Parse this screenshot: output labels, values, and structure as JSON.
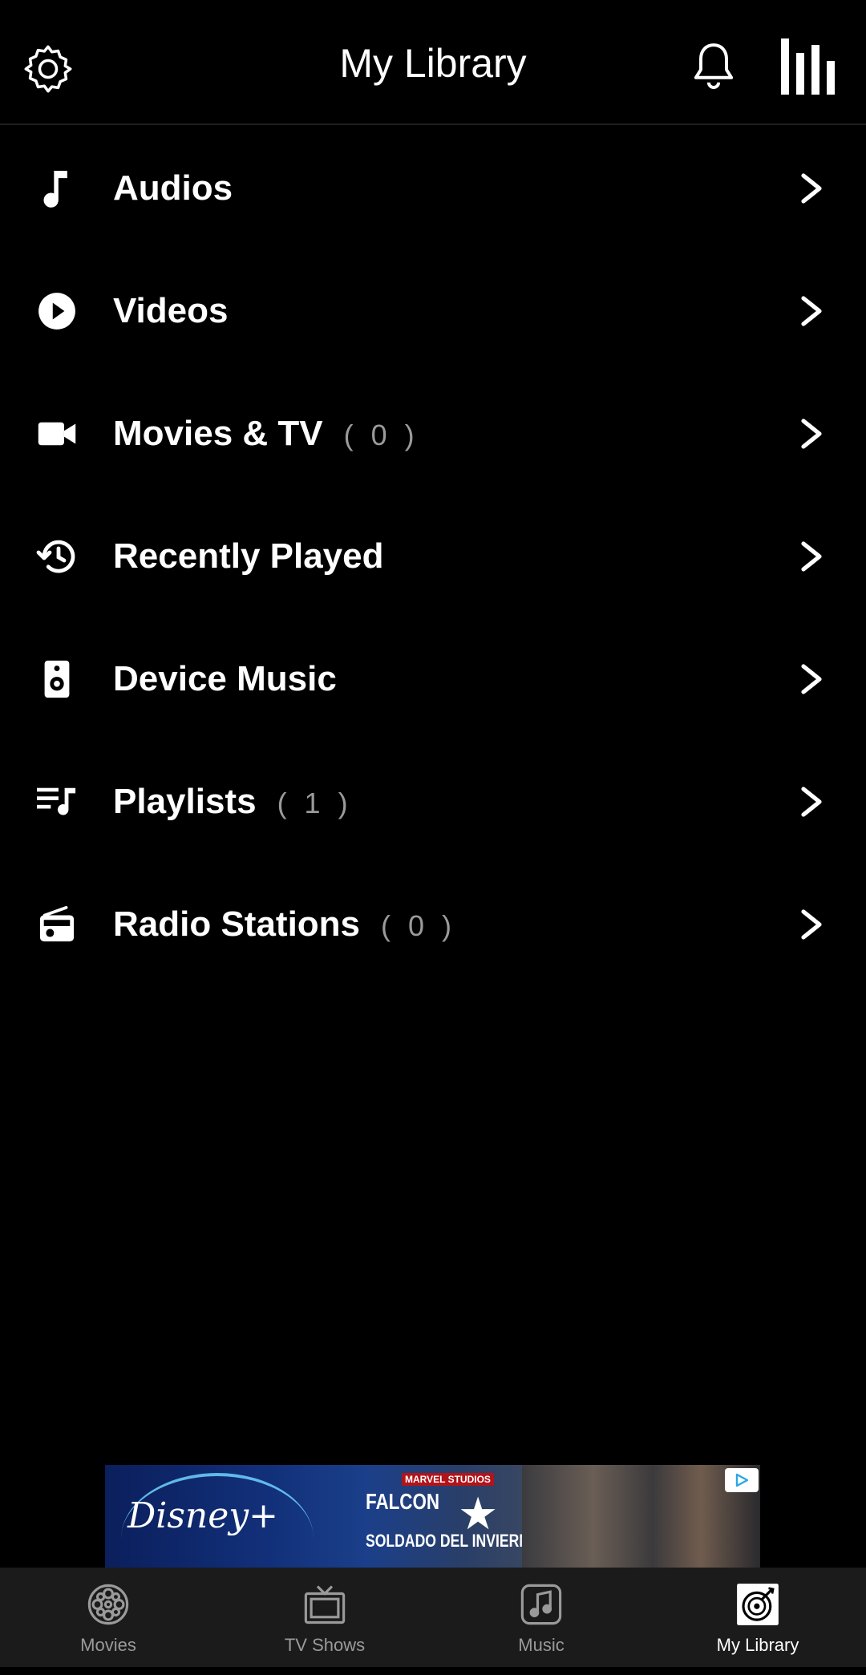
{
  "header": {
    "title": "My Library",
    "settings_icon": "gear-icon",
    "notifications_icon": "bell-icon",
    "equalizer_icon": "equalizer-icon"
  },
  "library_items": [
    {
      "label": "Audios",
      "count": "",
      "icon": "music-note-icon"
    },
    {
      "label": "Videos",
      "count": "",
      "icon": "play-circle-icon"
    },
    {
      "label": "Movies & TV",
      "count": "( 0 )",
      "icon": "video-camera-icon"
    },
    {
      "label": "Recently Played",
      "count": "",
      "icon": "history-icon"
    },
    {
      "label": "Device Music",
      "count": "",
      "icon": "speaker-icon"
    },
    {
      "label": "Playlists",
      "count": "( 1 )",
      "icon": "playlist-icon"
    },
    {
      "label": "Radio Stations",
      "count": "( 0 )",
      "icon": "radio-icon"
    }
  ],
  "ad": {
    "brand": "Disney+",
    "studio": "MARVEL STUDIOS",
    "headline_line1": "FALCON",
    "headline_line2": "SOLDADO DEL INVIERNO"
  },
  "bottom_nav": [
    {
      "label": "Movies",
      "icon": "film-reel-icon",
      "active": false
    },
    {
      "label": "TV Shows",
      "icon": "tv-icon",
      "active": false
    },
    {
      "label": "Music",
      "icon": "music-note-icon",
      "active": false
    },
    {
      "label": "My Library",
      "icon": "library-disc-icon",
      "active": true
    }
  ],
  "colors": {
    "background": "#000000",
    "text": "#ffffff",
    "muted": "#9a9a9a",
    "nav_background": "#1b1b1b"
  }
}
